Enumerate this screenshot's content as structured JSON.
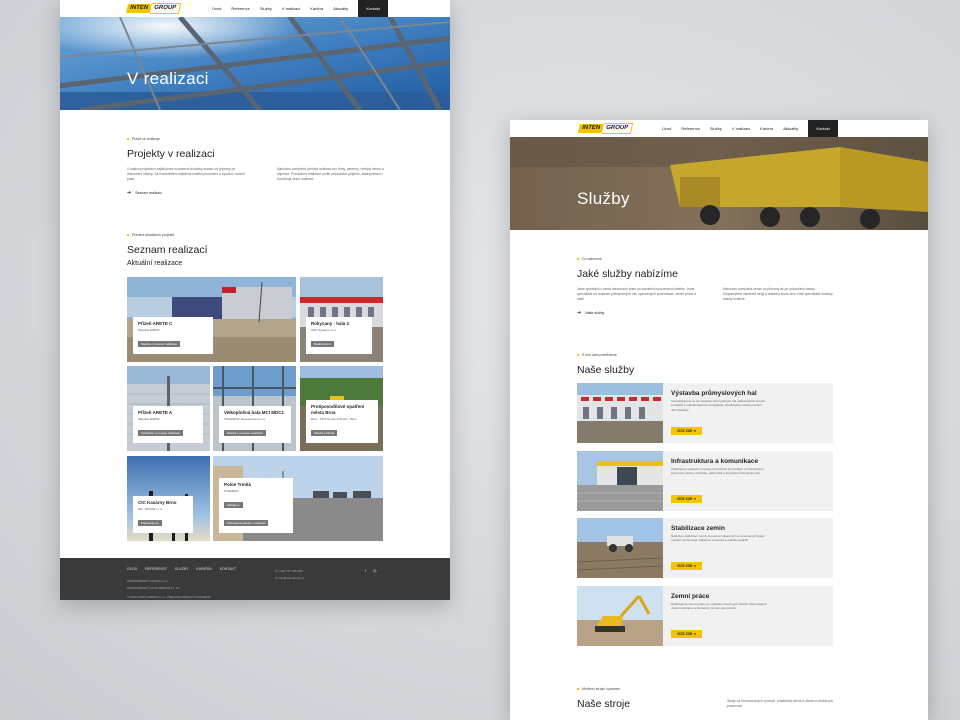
{
  "brand": {
    "logo_main": "INTEN",
    "logo_sub": "GROUP",
    "accent": "#f2c500",
    "dark": "#222222"
  },
  "nav": {
    "items": [
      "Úvod",
      "Reference",
      "Služby",
      "V realizaci",
      "Kariéra",
      "Aktuality"
    ],
    "contact": "Kontakt"
  },
  "page1": {
    "hero_title": "V realizaci",
    "intro": {
      "tag": "Právě se realizuje",
      "title": "Projekty v realizaci",
      "text_left": "V našich projektech zajišťujeme komplexní dodávky staveb od přípravy po dokončení stavby. Za zhotovitelem zajistíme kvalitní provedení a vysokou úroveň prací.",
      "text_right": "Nabízíme kompletní přehled realizací pro firmy, partnery, veřejný sektor a zájemce. Provádíme realizace podle požadavků projektu, stavbyvedoucí koordinují celou realizaci.",
      "link": "Seznam realizací"
    },
    "list": {
      "tag": "Přehled aktuálních projektů",
      "title": "Seznam realizací",
      "subtitle": "Aktuální realizace"
    },
    "projects": [
      {
        "title": "Přízeň ARETE C",
        "sub": "Skupina ARETE",
        "status": "Stavba v procesu realizace"
      },
      {
        "title": "Rokycany - hala 2",
        "sub": "SGF Systems s.r.o.",
        "status": "Realizováno"
      },
      {
        "title": "Přízeň ARETE A",
        "sub": "Skupina ARETE",
        "status": "Výstavba v procesu realizace"
      },
      {
        "title": "Velkoplošná hala MCI MDC1",
        "sub": "TRANSPOL Development s.r.o.",
        "status": "Stavba v procesu realizace"
      },
      {
        "title": "Protipovodňové opatření města Brna",
        "sub": "Brno - PPO Komín & Bystrc - Brno",
        "status": "Stavba probíhá"
      },
      {
        "title": "CIC Kasárny Brno",
        "sub": "MS - SPACE s.r.o.",
        "status": "Připravuje se"
      },
      {
        "title": "Poloe Trmitá",
        "sub": "STRABAG",
        "status": "Zahájeno",
        "status2": "Připravena stavba v realizaci"
      }
    ],
    "footer": {
      "menu": [
        "ÚVOD",
        "REFERENCE",
        "SLUŽBY",
        "KARIÉRA",
        "KONTAKT"
      ],
      "company": "ZÁPADOČESKÝ GROUP s.r.o.",
      "address": "ZÁPADOČESKÝ 32 PLZEŇSKÁ 12, 12",
      "phone": "+420 777 785 286",
      "email": "info@intengroup.cz",
      "copyright": "© 2020 INTEN GROUP s.r.o. VŠECHNA PRÁVA VYHRAZENA"
    }
  },
  "page2": {
    "hero_title": "Služby",
    "intro": {
      "tag": "Co nabízíme",
      "title": "Jaké služby nabízíme",
      "text_left": "Jsme spolehliví v rámci stavebních prací na stavebních pozemcích stavby. Jsme specialisté na realizaci průmyslových hal, zpevněných komunikací, zemní práce a další.",
      "text_right": "Nabízíme kompletní servis od přípravy až po dokončení stavby. Disponujeme vlastními stroji a vlastním know-how. Naši specialisté realizují stavby kvalitně.",
      "link": "Naše služby"
    },
    "services": {
      "tag": "S čím vám pomůžeme",
      "title": "Naše služby",
      "button": "VÍCE ZDE",
      "items": [
        {
          "title": "Výstavba průmyslových hal",
          "text": "Specializujeme se na výstavbu průmyslových hal, skladovacích prostor a objektů s nadstandardními požadavky. Realizujeme stavby na klíč i dílčí dodávky."
        },
        {
          "title": "Infrastruktura a komunikace",
          "text": "Zajišťujeme výstavbu a opravy pozemních komunikací a infrastruktury. Zpevněné plochy, chodníky, parkoviště a kompletní inženýrské sítě."
        },
        {
          "title": "Stabilizace zemin",
          "text": "Nabízíme stabilizaci zemin za pomoci vápenných a cementových pojiv moderní technologií. Zajistíme únosnost a stabilitu podloží."
        },
        {
          "title": "Zemní práce",
          "text": "Realizujeme zemní práce pro výstavbu všech typů staveb. Disponujeme vlastní technikou a zkušeným týmem pracovníků."
        }
      ]
    },
    "machines": {
      "tag": "Moderní strojní vybavení",
      "title": "Naše stroje",
      "text": "Stroje od renomovaných výrobců, pravidelný servis a zkušení obsluhující pracovníci."
    }
  }
}
